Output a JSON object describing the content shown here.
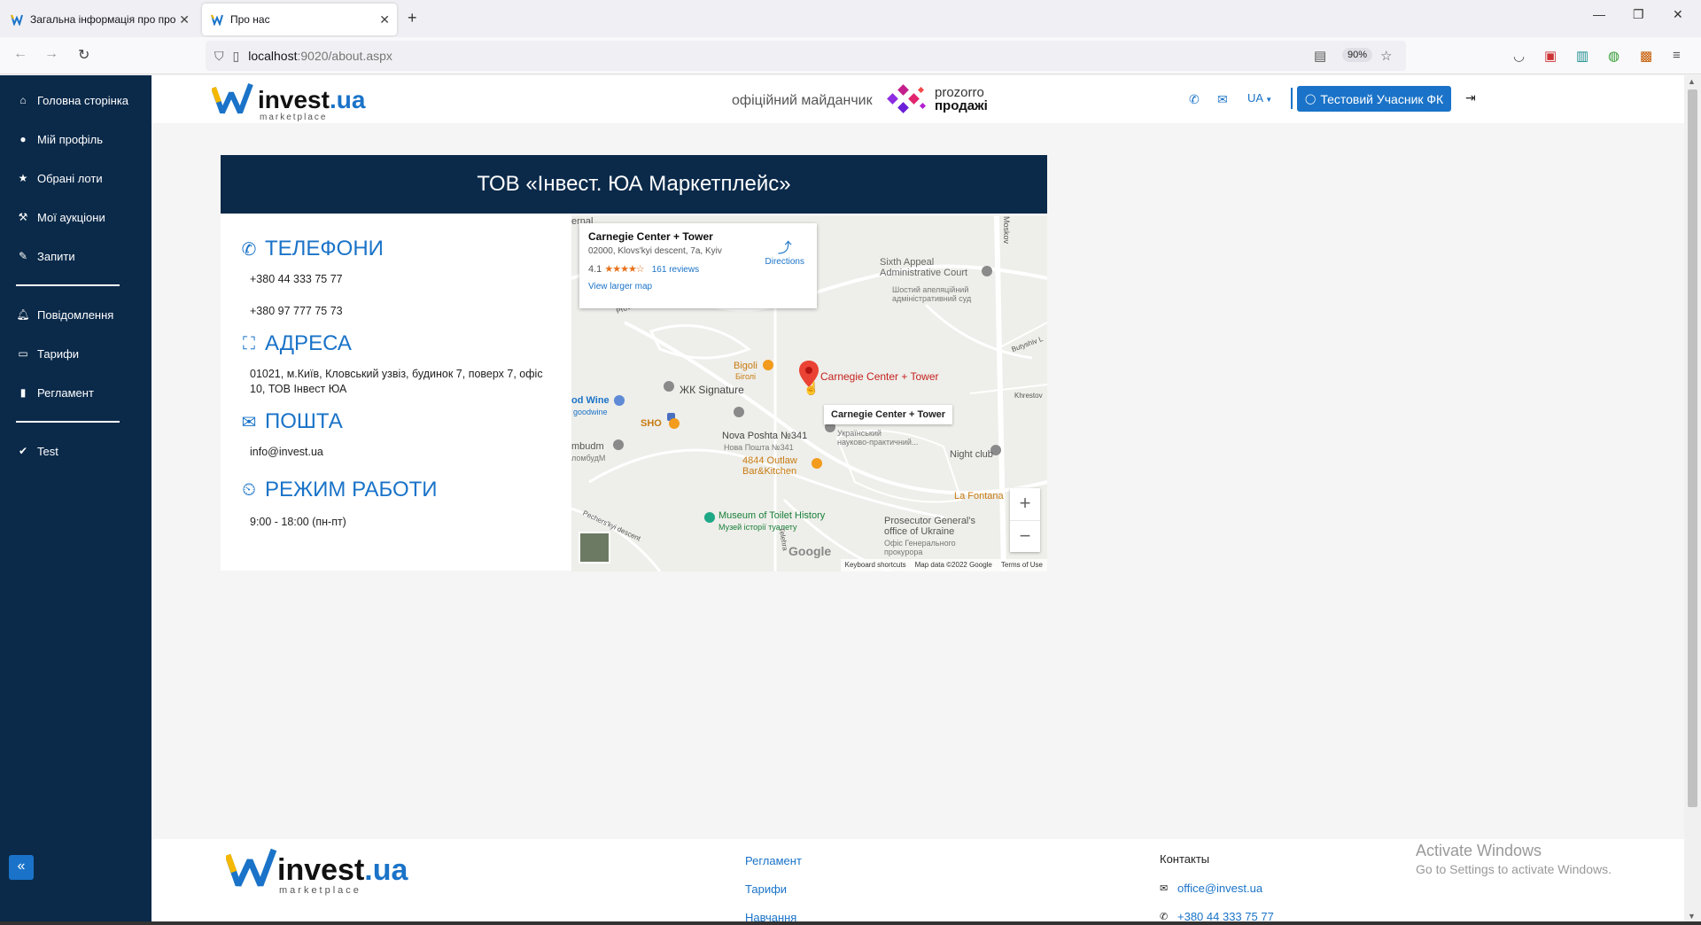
{
  "browser": {
    "tabs": [
      {
        "title": "Загальна інформація про про"
      },
      {
        "title": "Про нас"
      }
    ],
    "url_host": "localhost",
    "url_rest": ":9020/about.aspx",
    "zoom": "90%"
  },
  "sidebar": {
    "items": [
      {
        "label": "Головна сторінка",
        "icon": "home-icon"
      },
      {
        "label": "Мій профіль",
        "icon": "user-icon"
      },
      {
        "label": "Обрані лоти",
        "icon": "star-icon"
      },
      {
        "label": "Мої аукціони",
        "icon": "gavel-icon"
      },
      {
        "label": "Запити",
        "icon": "pencil-icon"
      },
      {
        "label": "Повідомлення",
        "icon": "bell-icon"
      },
      {
        "label": "Тарифи",
        "icon": "money-icon"
      },
      {
        "label": "Регламент",
        "icon": "book-icon"
      },
      {
        "label": "Test",
        "icon": "check-circle-icon"
      }
    ],
    "collapse_label": "«"
  },
  "header": {
    "logo_main": "invest",
    "logo_tld": ".ua",
    "logo_sub": "marketplace",
    "official": "офіційний майданчик",
    "prozorro_line1": "prozorro",
    "prozorro_line2": "продажі",
    "lang": "UA",
    "user_button": "Тестовий Учасник ФК"
  },
  "main": {
    "banner_title": "ТОВ «Інвест. ЮА Маркетплейс»",
    "phones_heading": "ТЕЛЕФОНИ",
    "phone1": "+380 44 333 75 77",
    "phone2": "+380 97 777 75 73",
    "address_heading": "АДРЕСА",
    "address": "01021, м.Київ, Кловський узвіз, будинок 7, поверх 7, офіс 10, ТОВ Інвест ЮА",
    "mail_heading": "ПОШТА",
    "email": "info@invest.ua",
    "hours_heading": "РЕЖИМ РАБОТИ",
    "hours": "9:00 - 18:00 (пн-пт)"
  },
  "map": {
    "card_title": "Carnegie Center + Tower",
    "card_address": "02000, Klovs'kyi descent, 7a, Kyiv",
    "rating": "4.1",
    "stars": "★★★★☆",
    "reviews": "161 reviews",
    "view_larger": "View larger map",
    "directions": "Directions",
    "tooltip": "Carnegie Center + Tower",
    "pin_label": "Carnegie Center + Tower",
    "labels": {
      "court": "Sixth Appeal\nAdministrative Court",
      "court_ua": "Шостий апеляційний\nадміністративний суд",
      "bigoli": "Bigoli",
      "bigoli_ua": "Біголі",
      "zhk": "ЖК Signature",
      "goodwine": "od Wine",
      "goodwine_ua": "goodwine",
      "sho": "SHO",
      "novaposhta": "Nova Poshta №341",
      "novaposhta_ua": "Нова Пошта №341",
      "outlaw": "4844 Outlaw\nBar&Kitchen",
      "nightclub": "Night club",
      "lafontana": "La Fontana",
      "museum": "Museum of Toilet History",
      "museum_ua": "Музей історії туалету",
      "prosecutor": "Prosecutor General's\noffice of Ukraine",
      "prosecutor_ua": "Офіс Генерального\nпрокурора",
      "ukr": "Український\nнауково-практичний...",
      "khrestov": "Khrestov",
      "butyshiv": "Butyshiv L",
      "moskov": "Moskov",
      "pechers": "Pechers'kyi descent",
      "prov": "Prov. Ku",
      "imbudm": "mbudm",
      "imbudm_ua": "ломбудМ",
      "tele": "Telehra",
      "ernal": "ernal"
    },
    "google": "Google",
    "footer": [
      "Keyboard shortcuts",
      "Map data ©2022 Google",
      "Terms of Use"
    ]
  },
  "footer": {
    "links": [
      "Регламент",
      "Тарифи",
      "Навчання"
    ],
    "contacts_title": "Контакты",
    "email": "office@invest.ua",
    "phone": "+380 44 333 75 77"
  },
  "watermark": {
    "line1": "Activate Windows",
    "line2": "Go to Settings to activate Windows."
  },
  "colors": {
    "sidebar": "#0b2a4a",
    "accent": "#1a73c8"
  }
}
